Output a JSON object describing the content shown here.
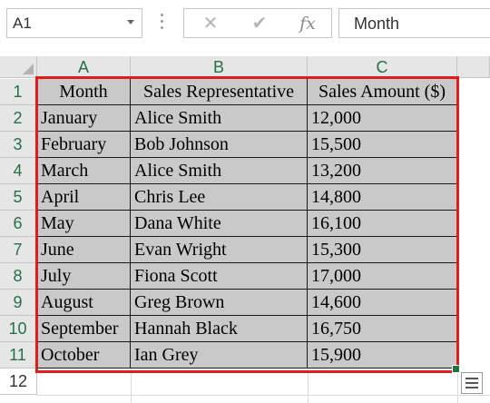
{
  "formula_bar": {
    "name_box": "A1",
    "formula": "Month",
    "icons": [
      "cancel-icon",
      "enter-icon",
      "insert-function-icon"
    ],
    "fx_label": "fx"
  },
  "columns": [
    "A",
    "B",
    "C"
  ],
  "rows": [
    "1",
    "2",
    "3",
    "4",
    "5",
    "6",
    "7",
    "8",
    "9",
    "10",
    "11",
    "12"
  ],
  "table": {
    "headers": [
      "Month",
      "Sales Representative",
      "Sales Amount ($)"
    ],
    "data": [
      [
        "January",
        "Alice Smith",
        "12,000"
      ],
      [
        "February",
        "Bob Johnson",
        "15,500"
      ],
      [
        "March",
        "Alice Smith",
        "13,200"
      ],
      [
        "April",
        "Chris Lee",
        "14,800"
      ],
      [
        "May",
        "Dana White",
        "16,100"
      ],
      [
        "June",
        "Evan Wright",
        "15,300"
      ],
      [
        "July",
        "Fiona Scott",
        "17,000"
      ],
      [
        "August",
        "Greg Brown",
        "14,600"
      ],
      [
        "September",
        "Hannah Black",
        "16,750"
      ],
      [
        "October",
        "Ian Grey",
        "15,900"
      ]
    ]
  },
  "colors": {
    "accent": "#217346",
    "selection_border": "#e21b1b",
    "cell_fill": "#c9c9c9"
  }
}
